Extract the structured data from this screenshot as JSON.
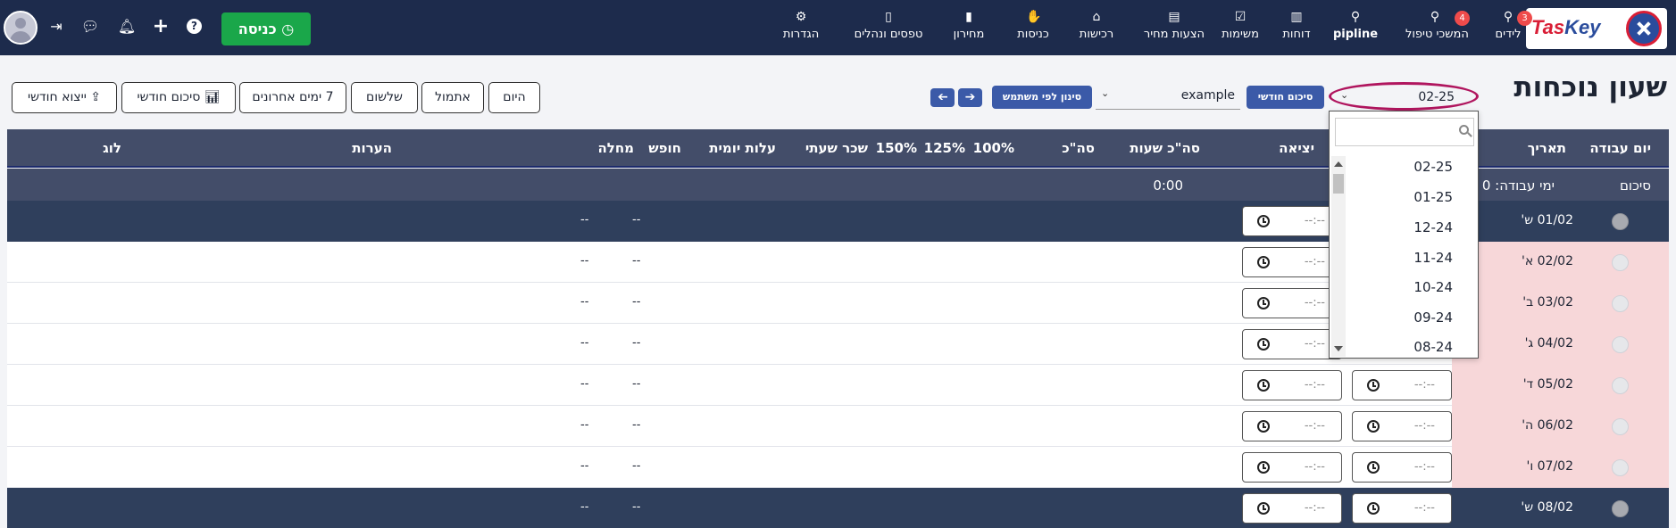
{
  "brand": {
    "logo_a": "Tas",
    "logo_b": "Key"
  },
  "nav": [
    {
      "id": "leads",
      "label": "לידים",
      "icon": "lead-icon",
      "badge": "3"
    },
    {
      "id": "followup",
      "label": "המשכי טיפול",
      "icon": "followup-icon",
      "badge": "4"
    },
    {
      "id": "pipline",
      "label": "pipline",
      "icon": "pipeline-icon",
      "badge": ""
    },
    {
      "id": "reports",
      "label": "דוחות",
      "icon": "bar-chart-icon",
      "badge": ""
    },
    {
      "id": "tasks",
      "label": "משימות",
      "icon": "checkbox-icon",
      "badge": ""
    },
    {
      "id": "quotes",
      "label": "הצעות מחיר",
      "icon": "document-icon",
      "badge": ""
    },
    {
      "id": "purchases",
      "label": "רכישות",
      "icon": "purchase-icon",
      "badge": ""
    },
    {
      "id": "incomes",
      "label": "כניסות",
      "icon": "handshake-icon",
      "badge": ""
    },
    {
      "id": "pricelist",
      "label": "מחירון",
      "icon": "barcode-icon",
      "badge": ""
    },
    {
      "id": "forms",
      "label": "טפסים ונהלים",
      "icon": "book-icon",
      "badge": ""
    },
    {
      "id": "settings",
      "label": "הגדרות",
      "icon": "gear-icon",
      "badge": ""
    }
  ],
  "enter_button": "כניסה",
  "page_title": "שעון נוכחות",
  "month_select": {
    "value": "02-25"
  },
  "monthly_summary_btn": "סיכום חודשי",
  "user_select": {
    "value": "example"
  },
  "filter_by_user_btn": "סינון לפי משתמש",
  "filters": {
    "today": "היום",
    "yesterday": "אתמול",
    "day_before": "שלשום",
    "last7": "7 ימים אחרונים",
    "monthly_summary": "סיכום חודשי",
    "monthly_export": "ייצוא חודשי"
  },
  "headers": {
    "workday": "יום עבודה",
    "date": "תאריך",
    "exit": "יציאה",
    "total_hours": "סה\"כ שעות",
    "total": "סה\"כ",
    "p100": "100%",
    "p125": "125%",
    "p150": "150%",
    "hourly_wage": "שכר שעתי",
    "daily_cost": "עלות יומית",
    "vacation": "חופש",
    "sick": "מחלה",
    "notes": "הערות",
    "log": "לוג"
  },
  "summary": {
    "label": "סיכום",
    "workdays": "ימי עבודה: 0",
    "hours": "0:00"
  },
  "time_placeholder": "--:--",
  "dash": "--",
  "rows": [
    {
      "date": "01/02 ש'",
      "weekend": true,
      "entry_visible": false
    },
    {
      "date": "02/02 א'",
      "weekend": false,
      "entry_visible": false
    },
    {
      "date": "03/02 ב'",
      "weekend": false,
      "entry_visible": false
    },
    {
      "date": "04/02 ג'",
      "weekend": false,
      "entry_visible": false
    },
    {
      "date": "05/02 ד'",
      "weekend": false,
      "entry_visible": true
    },
    {
      "date": "06/02 ה'",
      "weekend": false,
      "entry_visible": true
    },
    {
      "date": "07/02 ו'",
      "weekend": false,
      "entry_visible": true
    },
    {
      "date": "08/02 ש'",
      "weekend": true,
      "entry_visible": true
    }
  ],
  "month_options": [
    "02-25",
    "01-25",
    "12-24",
    "11-24",
    "10-24",
    "09-24",
    "08-24"
  ],
  "colors": {
    "nav_bg": "#1d2b4c",
    "enter_green": "#1aa74a",
    "accent_blue": "#3b5aa8",
    "highlight_ring": "#b0155e",
    "date_cell_pink": "#f7d7d9",
    "badge_red": "#ef4b4b"
  }
}
